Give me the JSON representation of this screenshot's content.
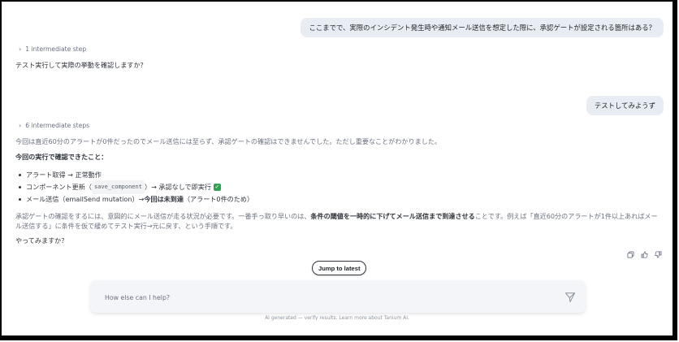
{
  "conversation": {
    "user_message_1": "ここまでで、実際のインシデント発生時や通知メール送信を想定した際に、承認ゲートが設定される箇所はある？",
    "step_toggle_1": "1 intermediate step",
    "assistant_message_1": "テスト実行して実際の挙動を確認しますか？",
    "user_message_2": "テストしてみようず",
    "step_toggle_2": "6 intermediate steps",
    "assistant_message_2": {
      "intro": "今回は直近60分のアラートが0件だったのでメール送信には至らず、承認ゲートの確認はできませんでした。ただし重要なことがわかりました。",
      "heading": "今回の実行で確認できたこと：",
      "bullets": [
        {
          "text": "アラート取得 → 正常動作"
        },
        {
          "before": "コンポーネント更新（",
          "code": "save_component",
          "after": "）→ 承認なしで即実行",
          "check": "✓"
        },
        {
          "before": "メール送信（emailSend mutation）→ ",
          "bold": "今回は未到達",
          "after": "（アラート0件のため）"
        }
      ],
      "para_1": "承認ゲートの確認をするには、意図的にメール送信が走る状況が必要です。一番手っ取り早いのは、",
      "para_bold": "条件の閾値を一時的に下げてメール送信まで到達させる",
      "para_2": "ことです。例えば「直近60分のアラートが1件以上あればメール送信する」に条件を仮で緩めてテスト実行→元に戻す、という手順です。",
      "closing": "やってみますか？"
    }
  },
  "jump_to_latest": "Jump to latest",
  "composer": {
    "placeholder": "How else can I help?"
  },
  "footer": "AI generated — verify results. Learn more about Tanium AI."
}
